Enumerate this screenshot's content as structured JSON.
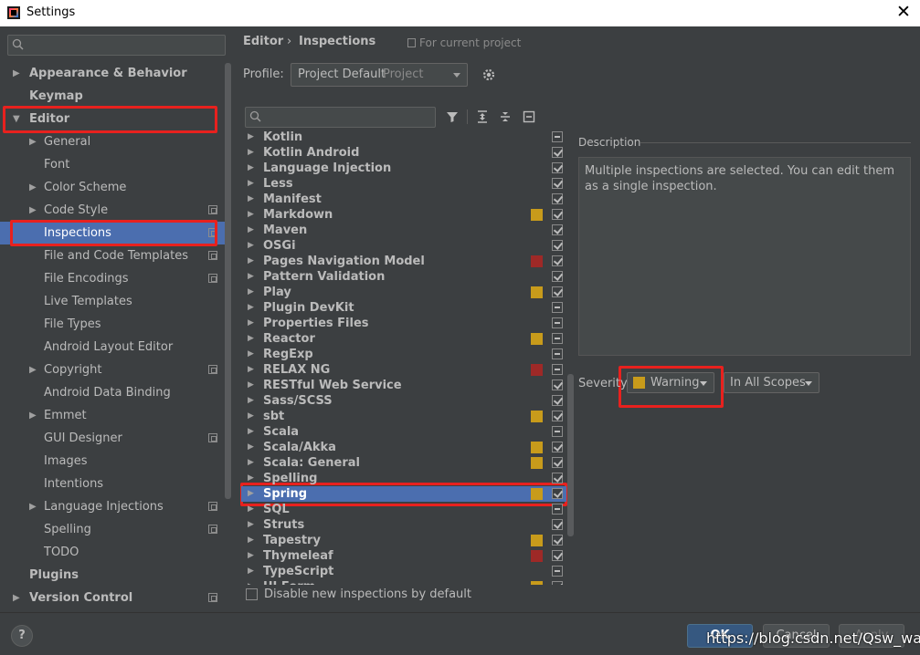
{
  "window": {
    "title": "Settings",
    "close_glyph": "✕"
  },
  "sidebar": {
    "search_placeholder": "",
    "items": [
      {
        "label": "Appearance & Behavior",
        "level": 0,
        "bold": true,
        "arrow": "▶"
      },
      {
        "label": "Keymap",
        "level": 0,
        "bold": true,
        "arrow": ""
      },
      {
        "label": "Editor",
        "level": 0,
        "bold": true,
        "arrow": "▼"
      },
      {
        "label": "General",
        "level": 1,
        "arrow": "▶"
      },
      {
        "label": "Font",
        "level": 1,
        "arrow": ""
      },
      {
        "label": "Color Scheme",
        "level": 1,
        "arrow": "▶"
      },
      {
        "label": "Code Style",
        "level": 1,
        "arrow": "▶",
        "project": true
      },
      {
        "label": "Inspections",
        "level": 1,
        "arrow": "",
        "project": true,
        "selected": true
      },
      {
        "label": "File and Code Templates",
        "level": 1,
        "arrow": "",
        "project": true
      },
      {
        "label": "File Encodings",
        "level": 1,
        "arrow": "",
        "project": true
      },
      {
        "label": "Live Templates",
        "level": 1,
        "arrow": ""
      },
      {
        "label": "File Types",
        "level": 1,
        "arrow": ""
      },
      {
        "label": "Android Layout Editor",
        "level": 1,
        "arrow": ""
      },
      {
        "label": "Copyright",
        "level": 1,
        "arrow": "▶",
        "project": true
      },
      {
        "label": "Android Data Binding",
        "level": 1,
        "arrow": ""
      },
      {
        "label": "Emmet",
        "level": 1,
        "arrow": "▶"
      },
      {
        "label": "GUI Designer",
        "level": 1,
        "arrow": "",
        "project": true
      },
      {
        "label": "Images",
        "level": 1,
        "arrow": ""
      },
      {
        "label": "Intentions",
        "level": 1,
        "arrow": ""
      },
      {
        "label": "Language Injections",
        "level": 1,
        "arrow": "▶",
        "project": true
      },
      {
        "label": "Spelling",
        "level": 1,
        "arrow": "",
        "project": true
      },
      {
        "label": "TODO",
        "level": 1,
        "arrow": ""
      },
      {
        "label": "Plugins",
        "level": 0,
        "bold": true,
        "arrow": ""
      },
      {
        "label": "Version Control",
        "level": 0,
        "bold": true,
        "arrow": "▶",
        "project": true
      }
    ]
  },
  "breadcrumb": {
    "part1": "Editor",
    "separator": "›",
    "part2": "Inspections",
    "project_note": "For current project"
  },
  "profile": {
    "label": "Profile:",
    "value": "Project Default",
    "scope": "Project"
  },
  "inspection_search_placeholder": "",
  "inspections": [
    {
      "label": "Kotlin",
      "severity": null,
      "check": "partial"
    },
    {
      "label": "Kotlin Android",
      "severity": null,
      "check": "on"
    },
    {
      "label": "Language Injection",
      "severity": null,
      "check": "on"
    },
    {
      "label": "Less",
      "severity": null,
      "check": "on"
    },
    {
      "label": "Manifest",
      "severity": null,
      "check": "on"
    },
    {
      "label": "Markdown",
      "severity": "#c89b1b",
      "check": "on"
    },
    {
      "label": "Maven",
      "severity": null,
      "check": "on"
    },
    {
      "label": "OSGi",
      "severity": null,
      "check": "on"
    },
    {
      "label": "Pages Navigation Model",
      "severity": "#9e2927",
      "check": "on"
    },
    {
      "label": "Pattern Validation",
      "severity": null,
      "check": "on"
    },
    {
      "label": "Play",
      "severity": "#c89b1b",
      "check": "on"
    },
    {
      "label": "Plugin DevKit",
      "severity": null,
      "check": "partial"
    },
    {
      "label": "Properties Files",
      "severity": null,
      "check": "partial"
    },
    {
      "label": "Reactor",
      "severity": "#c89b1b",
      "check": "partial"
    },
    {
      "label": "RegExp",
      "severity": null,
      "check": "partial"
    },
    {
      "label": "RELAX NG",
      "severity": "#9e2927",
      "check": "partial"
    },
    {
      "label": "RESTful Web Service",
      "severity": null,
      "check": "on"
    },
    {
      "label": "Sass/SCSS",
      "severity": null,
      "check": "on"
    },
    {
      "label": "sbt",
      "severity": "#c89b1b",
      "check": "on"
    },
    {
      "label": "Scala",
      "severity": null,
      "check": "partial"
    },
    {
      "label": "Scala/Akka",
      "severity": "#c89b1b",
      "check": "on"
    },
    {
      "label": "Scala: General",
      "severity": "#c89b1b",
      "check": "on"
    },
    {
      "label": "Spelling",
      "severity": null,
      "check": "on"
    },
    {
      "label": "Spring",
      "severity": "#c89b1b",
      "check": "on",
      "selected": true
    },
    {
      "label": "SQL",
      "severity": null,
      "check": "partial"
    },
    {
      "label": "Struts",
      "severity": null,
      "check": "on"
    },
    {
      "label": "Tapestry",
      "severity": "#c89b1b",
      "check": "on"
    },
    {
      "label": "Thymeleaf",
      "severity": "#9e2927",
      "check": "on"
    },
    {
      "label": "TypeScript",
      "severity": null,
      "check": "partial"
    },
    {
      "label": "UI Form",
      "severity": "#c89b1b",
      "check": "on"
    }
  ],
  "disable_new": {
    "label": "Disable new inspections by default",
    "checked": false
  },
  "description": {
    "title": "Description",
    "text": "Multiple inspections are selected. You can edit them as a single inspection."
  },
  "severity": {
    "label": "Severity:",
    "value": "Warning",
    "swatch": "#c89b1b",
    "scope": "In All Scopes"
  },
  "buttons": {
    "help": "?",
    "ok": "OK",
    "cancel": "Cancel",
    "apply": "Apply"
  },
  "watermark": "https://blog.csdn.net/Qsw_water",
  "colors": {
    "background": "#3c3f41",
    "selection": "#4b6eaf",
    "highlight_box": "#e8211e",
    "warning": "#c89b1b",
    "error": "#9e2927"
  }
}
